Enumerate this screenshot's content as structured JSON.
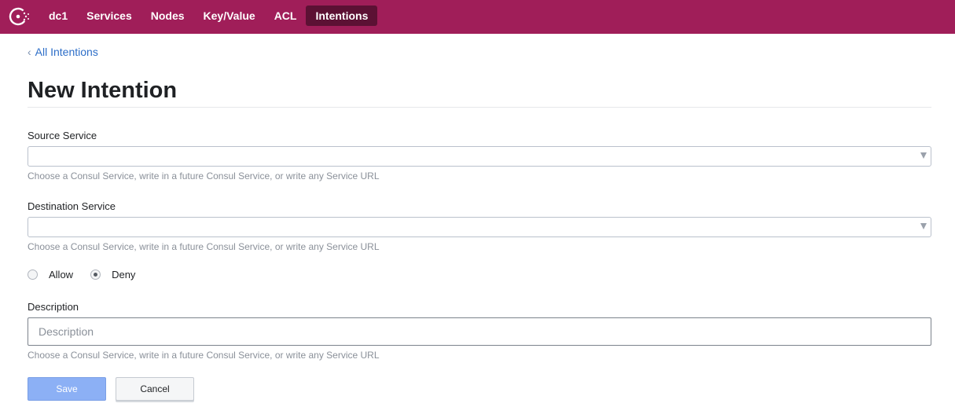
{
  "nav": {
    "items": [
      {
        "label": "dc1",
        "active": false
      },
      {
        "label": "Services",
        "active": false
      },
      {
        "label": "Nodes",
        "active": false
      },
      {
        "label": "Key/Value",
        "active": false
      },
      {
        "label": "ACL",
        "active": false
      },
      {
        "label": "Intentions",
        "active": true
      }
    ],
    "brand_color": "#a01e59",
    "active_color": "#5c1134"
  },
  "breadcrumb": {
    "label": "All Intentions"
  },
  "page": {
    "title": "New Intention"
  },
  "form": {
    "source": {
      "label": "Source Service",
      "value": "",
      "help": "Choose a Consul Service, write in a future Consul Service, or write any Service URL"
    },
    "destination": {
      "label": "Destination Service",
      "value": "",
      "help": "Choose a Consul Service, write in a future Consul Service, or write any Service URL"
    },
    "action": {
      "options": [
        {
          "label": "Allow",
          "checked": false
        },
        {
          "label": "Deny",
          "checked": true
        }
      ]
    },
    "description": {
      "label": "Description",
      "placeholder": "Description",
      "value": "",
      "help": "Choose a Consul Service, write in a future Consul Service, or write any Service URL"
    },
    "save_label": "Save",
    "cancel_label": "Cancel"
  }
}
